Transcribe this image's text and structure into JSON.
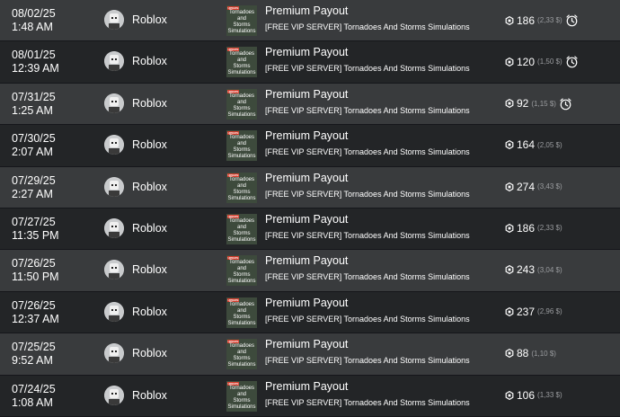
{
  "transactions": [
    {
      "date": "08/02/25",
      "time": "1:48 AM",
      "user": "Roblox",
      "title": "Premium Payout",
      "place": "[FREE VIP SERVER] Tornadoes And Storms Simulations",
      "amount": "186",
      "usd": "(2,33 $)",
      "pending": true
    },
    {
      "date": "08/01/25",
      "time": "12:39 AM",
      "user": "Roblox",
      "title": "Premium Payout",
      "place": "[FREE VIP SERVER] Tornadoes And Storms Simulations",
      "amount": "120",
      "usd": "(1,50 $)",
      "pending": true
    },
    {
      "date": "07/31/25",
      "time": "1:25 AM",
      "user": "Roblox",
      "title": "Premium Payout",
      "place": "[FREE VIP SERVER] Tornadoes And Storms Simulations",
      "amount": "92",
      "usd": "(1,15 $)",
      "pending": true
    },
    {
      "date": "07/30/25",
      "time": "2:07 AM",
      "user": "Roblox",
      "title": "Premium Payout",
      "place": "[FREE VIP SERVER] Tornadoes And Storms Simulations",
      "amount": "164",
      "usd": "(2,05 $)",
      "pending": false
    },
    {
      "date": "07/29/25",
      "time": "2:27 AM",
      "user": "Roblox",
      "title": "Premium Payout",
      "place": "[FREE VIP SERVER] Tornadoes And Storms Simulations",
      "amount": "274",
      "usd": "(3,43 $)",
      "pending": false
    },
    {
      "date": "07/27/25",
      "time": "11:35 PM",
      "user": "Roblox",
      "title": "Premium Payout",
      "place": "[FREE VIP SERVER] Tornadoes And Storms Simulations",
      "amount": "186",
      "usd": "(2,33 $)",
      "pending": false
    },
    {
      "date": "07/26/25",
      "time": "11:50 PM",
      "user": "Roblox",
      "title": "Premium Payout",
      "place": "[FREE VIP SERVER] Tornadoes And Storms Simulations",
      "amount": "243",
      "usd": "(3,04 $)",
      "pending": false
    },
    {
      "date": "07/26/25",
      "time": "12:37 AM",
      "user": "Roblox",
      "title": "Premium Payout",
      "place": "[FREE VIP SERVER] Tornadoes And Storms Simulations",
      "amount": "237",
      "usd": "(2,96 $)",
      "pending": false
    },
    {
      "date": "07/25/25",
      "time": "9:52 AM",
      "user": "Roblox",
      "title": "Premium Payout",
      "place": "[FREE VIP SERVER] Tornadoes And Storms Simulations",
      "amount": "88",
      "usd": "(1,10 $)",
      "pending": false
    },
    {
      "date": "07/24/25",
      "time": "1:08 AM",
      "user": "Roblox",
      "title": "Premium Payout",
      "place": "[FREE VIP SERVER] Tornadoes And Storms Simulations",
      "amount": "106",
      "usd": "(1,33 $)",
      "pending": false
    }
  ],
  "thumbnail": {
    "badge": "UPDATE",
    "lines": [
      "Tornadoes",
      "and",
      "Storms",
      "Simulations"
    ]
  },
  "icons": {
    "currency": "robux-icon",
    "pending": "clock-icon",
    "avatar": "roblox-avatar-icon"
  },
  "colors": {
    "row_odd": "#393b3d",
    "row_even": "#232527",
    "text": "#ffffff",
    "muted": "#9a9c9f",
    "badge": "#d23a2a"
  }
}
